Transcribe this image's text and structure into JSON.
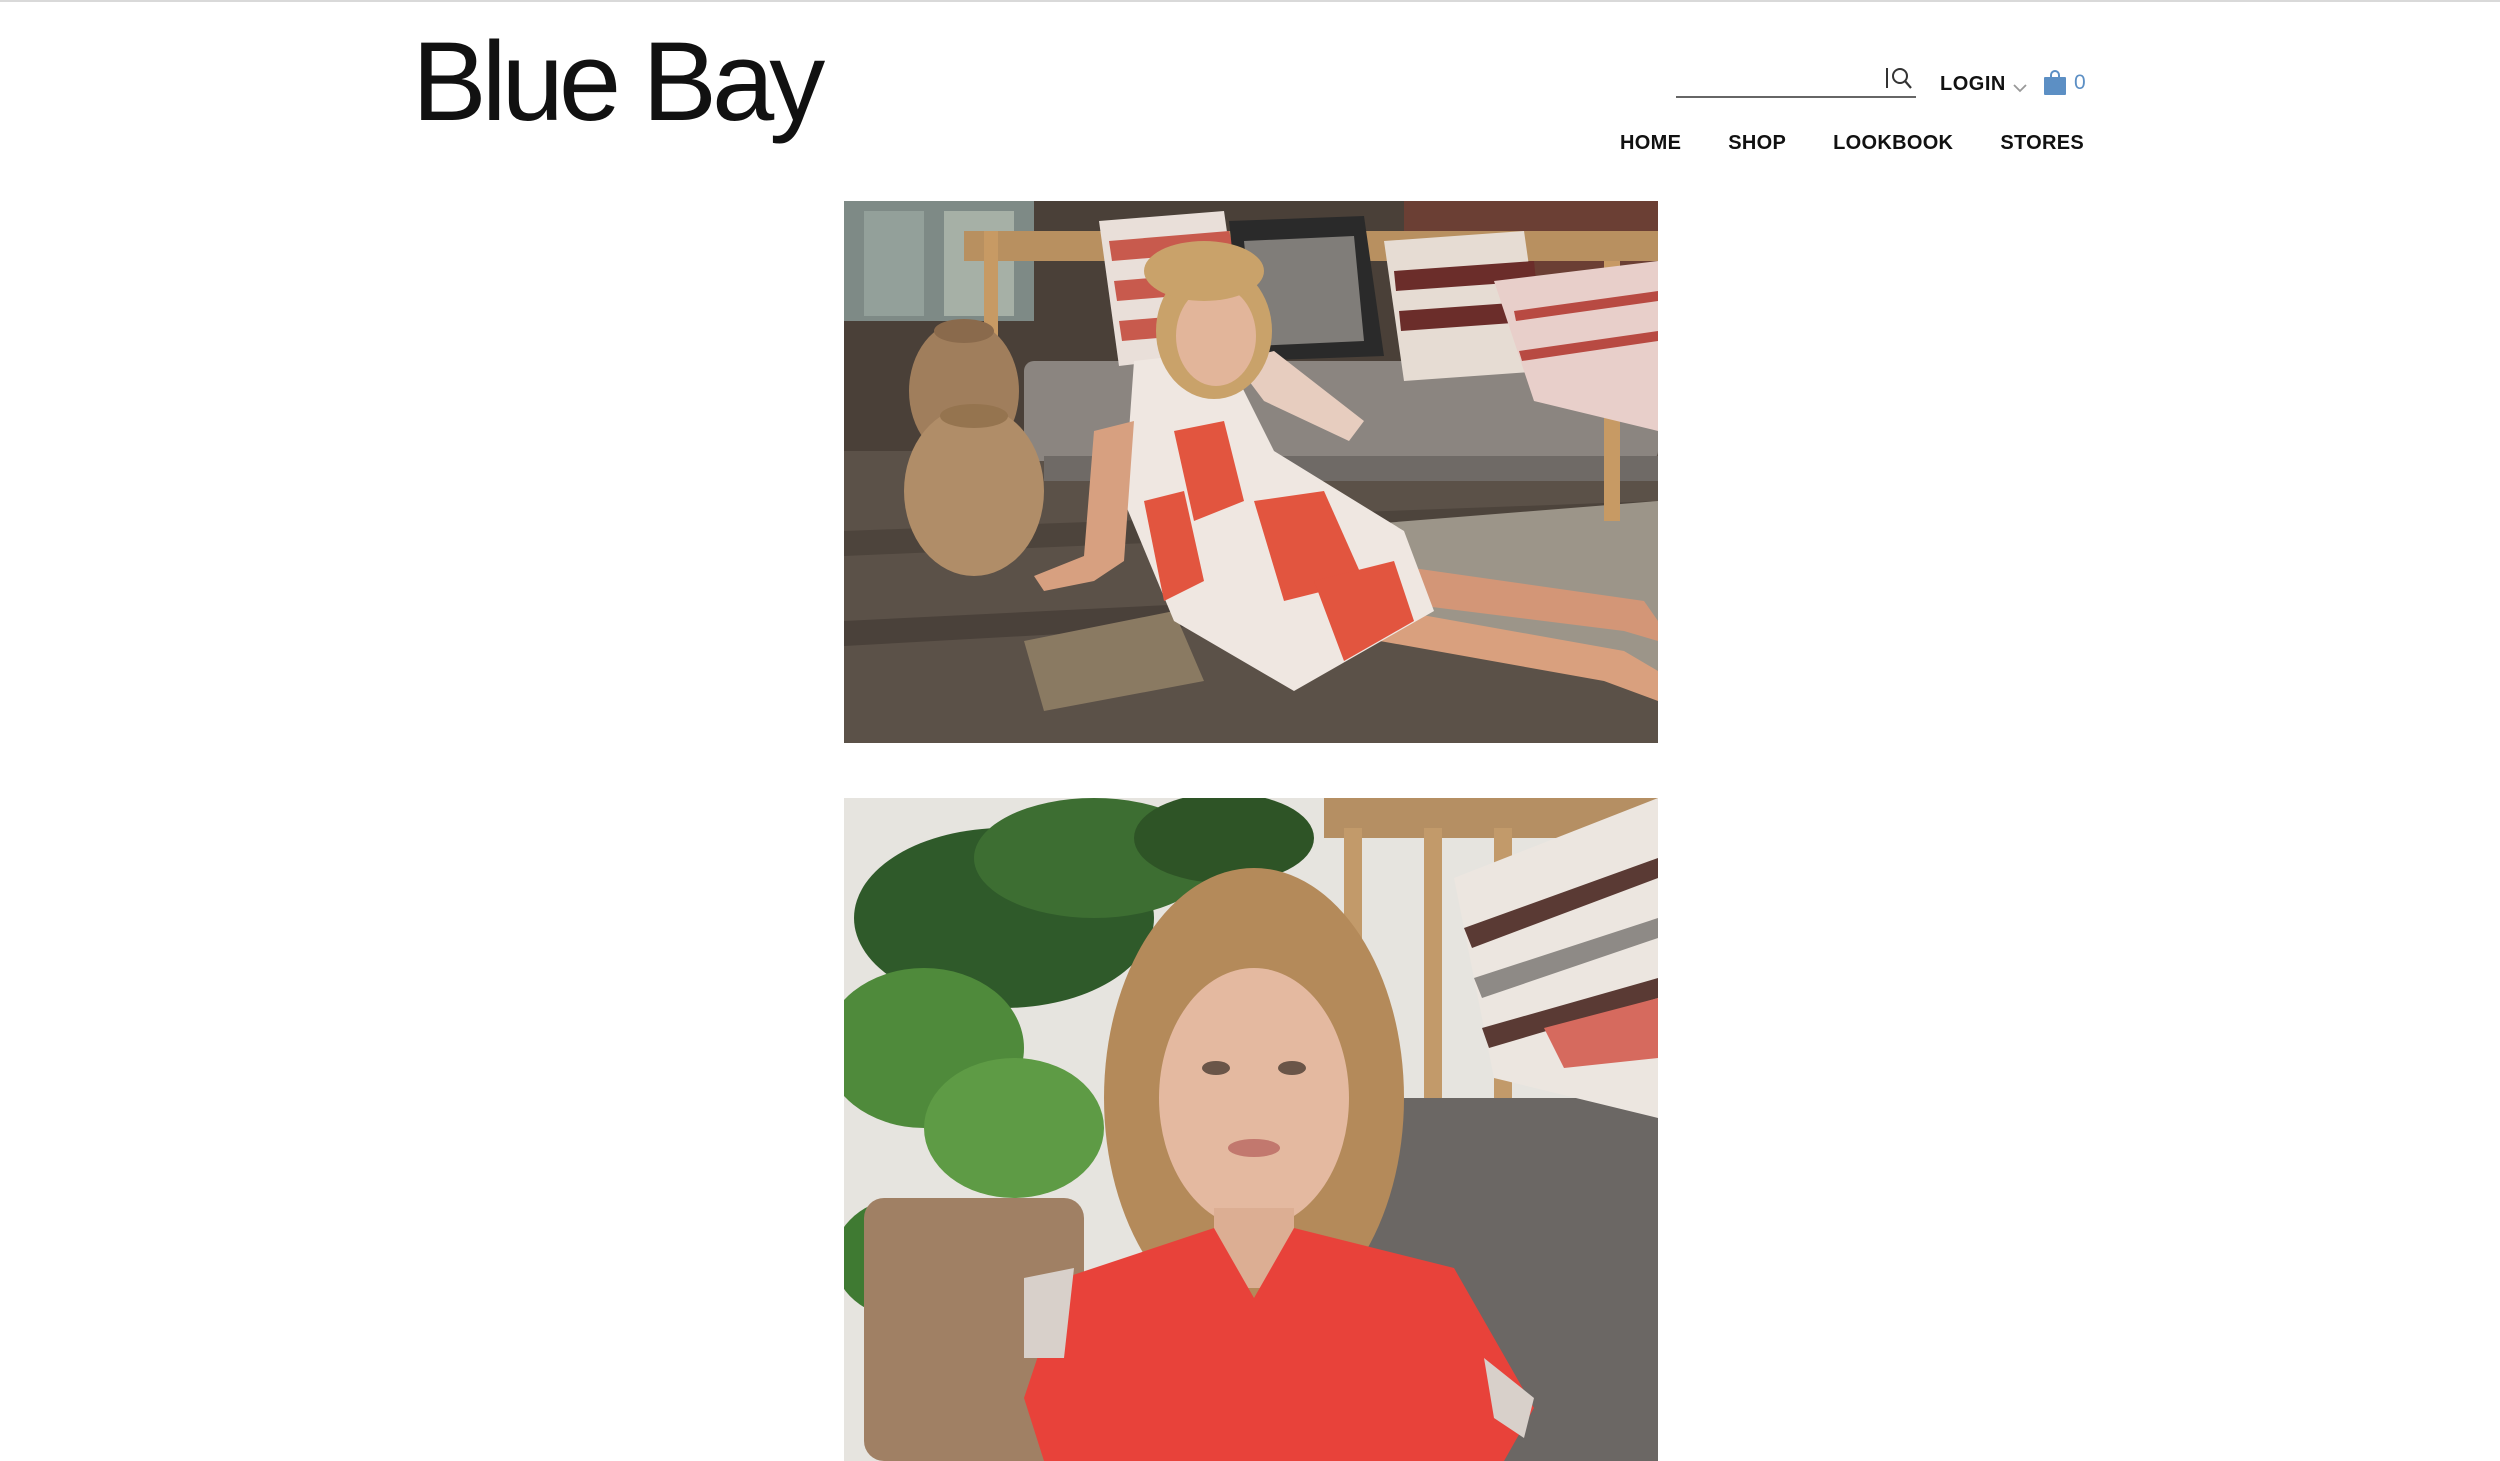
{
  "brand": {
    "logo_text": "Blue Bay"
  },
  "search": {
    "placeholder": "",
    "value": "",
    "icon": "search-icon"
  },
  "account": {
    "login_label": "LOGIN",
    "dropdown_icon": "chevron-down-icon"
  },
  "cart": {
    "icon": "shopping-bag-icon",
    "count": "0",
    "color": "#5c8fc4"
  },
  "nav": {
    "items": [
      {
        "label": "HOME"
      },
      {
        "label": "SHOP"
      },
      {
        "label": "LOOKBOOK"
      },
      {
        "label": "STORES"
      }
    ]
  },
  "lookbook": {
    "images": [
      {
        "subject": "woman in red and white floral wrap dress seated on wooden floor beside sofa with patterned cushions and woven baskets"
      },
      {
        "subject": "portrait of woman in red top in front of monstera plant and wooden bench with chevron cushion"
      }
    ]
  },
  "colors": {
    "text": "#111111",
    "accent": "#5c8fc4",
    "divider": "#d9d9d9"
  }
}
